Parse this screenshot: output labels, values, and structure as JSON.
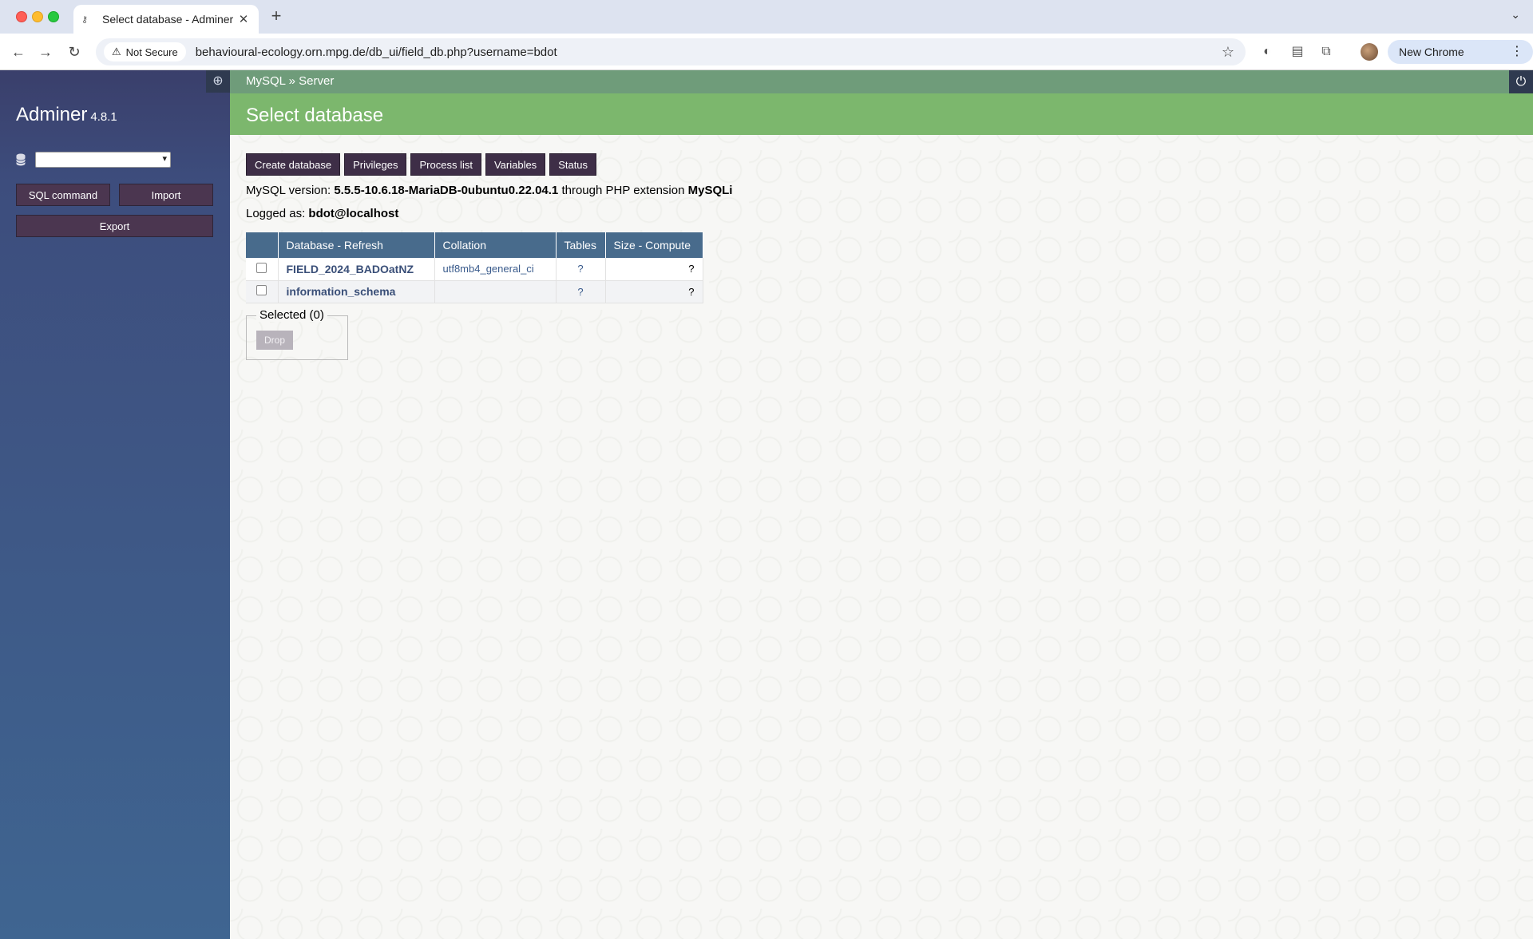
{
  "browser": {
    "tab_title": "Select database - Adminer",
    "tab_favicon": "key-icon",
    "new_tab_label": "+",
    "security_label": "Not Secure",
    "url": "behavioural-ecology.orn.mpg.de/db_ui/field_db.php?username=bdot",
    "new_chrome_label": "New Chrome available"
  },
  "sidebar": {
    "app_name": "Adminer",
    "version": "4.8.1",
    "db_select_value": "",
    "sql_command_label": "SQL command",
    "import_label": "Import",
    "export_label": "Export"
  },
  "header": {
    "breadcrumb": "MySQL » Server",
    "title": "Select database"
  },
  "actions": [
    "Create database",
    "Privileges",
    "Process list",
    "Variables",
    "Status"
  ],
  "info": {
    "version_prefix": "MySQL version:",
    "version_value": "5.5.5-10.6.18-MariaDB-0ubuntu0.22.04.1",
    "version_mid": "through PHP extension",
    "extension": "MySQLi",
    "logged_prefix": "Logged as:",
    "logged_user": "bdot@localhost"
  },
  "table": {
    "headers": {
      "database": "Database - Refresh",
      "collation": "Collation",
      "tables": "Tables",
      "size": "Size - Compute"
    },
    "rows": [
      {
        "name": "FIELD_2024_BADOatNZ",
        "collation": "utf8mb4_general_ci",
        "tables": "?",
        "size": "?"
      },
      {
        "name": "information_schema",
        "collation": "",
        "tables": "?",
        "size": "?"
      }
    ]
  },
  "selection": {
    "legend": "Selected (0)",
    "drop_label": "Drop"
  },
  "colors": {
    "sidebar_top": "#3a3f6b",
    "sidebar_bottom": "#3f6591",
    "title_bar": "#7cb76d",
    "breadcrumb_bar": "#6f9c7a",
    "table_header": "#486b8c",
    "button": "#3e2e47"
  }
}
